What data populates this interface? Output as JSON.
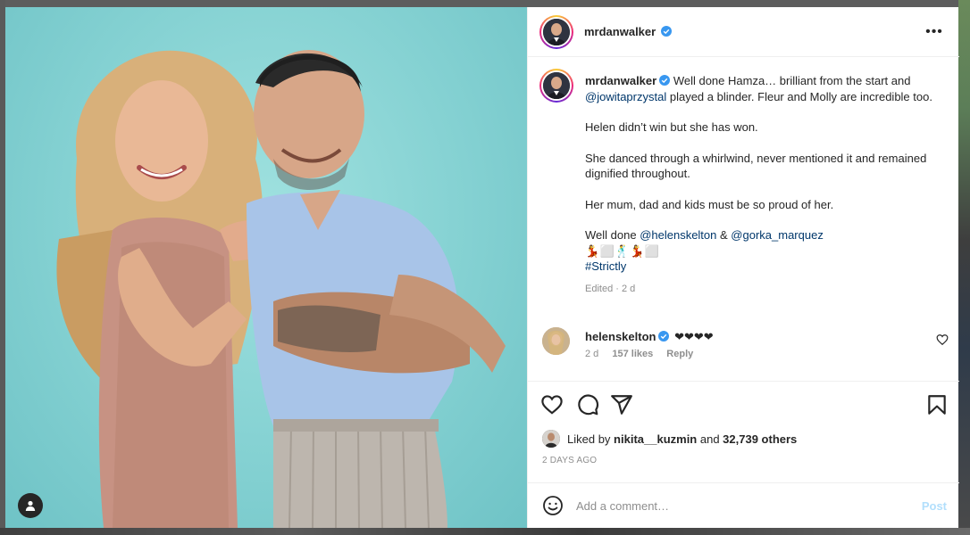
{
  "post": {
    "author": "mrdanwalker",
    "verified": true
  },
  "header": {
    "username": "mrdanwalker",
    "more_label": "•••"
  },
  "caption": {
    "username": "mrdanwalker",
    "line1_a": " Well done Hamza… brilliant from the start and ",
    "mention1": "@jowitaprzystal",
    "line1_b": " played a blinder. Fleur and Molly are incredible too.",
    "p2": "Helen didn’t win but she has won.",
    "p3": "She danced through a whirlwind, never mentioned it and remained dignified throughout.",
    "p4": "Her mum, dad and kids must be so proud of her.",
    "p5_a": "Well done ",
    "mention2": "@helenskelton",
    "p5_b": " & ",
    "mention3": "@gorka_marquez",
    "emoji_line": "💃⬜🕺💃⬜",
    "hashtag": "#Strictly",
    "edited": "Edited",
    "sep": " · ",
    "age": "2 d"
  },
  "comment": {
    "username": "helenskelton",
    "verified": true,
    "text": "❤❤❤❤",
    "age": "2 d",
    "likes": "157 likes",
    "reply": "Reply"
  },
  "likes": {
    "prefix": "Liked by ",
    "user": "nikita__kuzmin",
    "middle": " and ",
    "count": "32,739 others"
  },
  "timestamp": "2 DAYS AGO",
  "add_comment": {
    "placeholder": "Add a comment…",
    "post_label": "Post"
  },
  "colors": {
    "accent_blue": "#0095f6",
    "post_disabled": "#b2dffc",
    "mention": "#00376b",
    "verified": "#3897f0",
    "media_background": "#84d1d2"
  },
  "icons": [
    "more-icon",
    "verified-icon",
    "heart-icon",
    "comment-icon",
    "share-icon",
    "bookmark-icon",
    "emoji-icon",
    "tag-user-icon"
  ]
}
